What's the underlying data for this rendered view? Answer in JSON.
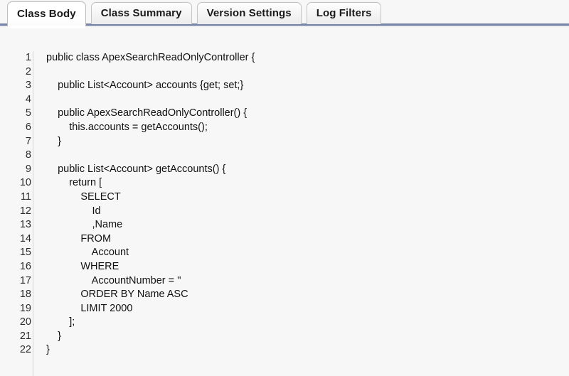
{
  "tabs": [
    {
      "label": "Class Body",
      "active": true,
      "name": "tab-class-body"
    },
    {
      "label": "Class Summary",
      "active": false,
      "name": "tab-class-summary"
    },
    {
      "label": "Version Settings",
      "active": false,
      "name": "tab-version-settings"
    },
    {
      "label": "Log Filters",
      "active": false,
      "name": "tab-log-filters"
    }
  ],
  "editor": {
    "language": "Apex",
    "line_count": 22,
    "line_numbers": [
      "1",
      "2",
      "3",
      "4",
      "5",
      "6",
      "7",
      "8",
      "9",
      "10",
      "11",
      "12",
      "13",
      "14",
      "15",
      "16",
      "17",
      "18",
      "19",
      "20",
      "21",
      "22"
    ],
    "lines": [
      "public class ApexSearchReadOnlyController {",
      "",
      "    public List<Account> accounts {get; set;}",
      "",
      "    public ApexSearchReadOnlyController() {",
      "        this.accounts = getAccounts();",
      "    }",
      "",
      "    public List<Account> getAccounts() {",
      "        return [",
      "            SELECT",
      "                Id",
      "                ,Name",
      "            FROM",
      "                Account",
      "            WHERE",
      "                AccountNumber = ''",
      "            ORDER BY Name ASC",
      "            LIMIT 2000",
      "        ];",
      "    }",
      "}"
    ]
  },
  "colors": {
    "page_background": "#f7f7f7",
    "tab_rule": "#7b87a8",
    "tab_border": "#c4c4c4",
    "active_tab_background": "#ffffff",
    "gutter_divider": "#d6d6d6",
    "code_text": "#111111",
    "line_number_text": "#2b2b2b"
  }
}
